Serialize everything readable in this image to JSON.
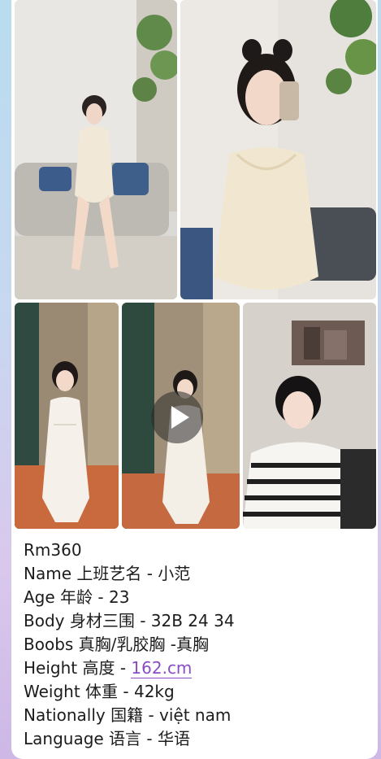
{
  "post": {
    "caption": {
      "price": "Rm360",
      "name": "Name 上班艺名 -  小范",
      "age": "Age 年龄 - 23",
      "body": "Body 身材三围 - 32B 24 34",
      "boobs": "Boobs 真胸/乳胶胸 -真胸",
      "height_prefix": "Height 高度 - ",
      "height_link": "162.cm",
      "weight": "Weight 体重 - 42kg",
      "nationality": "Nationally 国籍 - việt nam",
      "language": "Language 语言 - 华语"
    }
  },
  "photos": [
    {
      "name": "photo-sofa-wide",
      "type": "image"
    },
    {
      "name": "photo-selfie-closeup",
      "type": "image"
    },
    {
      "name": "photo-lace-dress",
      "type": "image"
    },
    {
      "name": "video-lace-dress",
      "type": "video"
    },
    {
      "name": "photo-striped-top",
      "type": "image"
    }
  ],
  "icons": {
    "video_play": "play-icon"
  },
  "colors": {
    "link": "#8a4cc4",
    "text": "#1c1c1c",
    "background": "#c7d8f0"
  }
}
